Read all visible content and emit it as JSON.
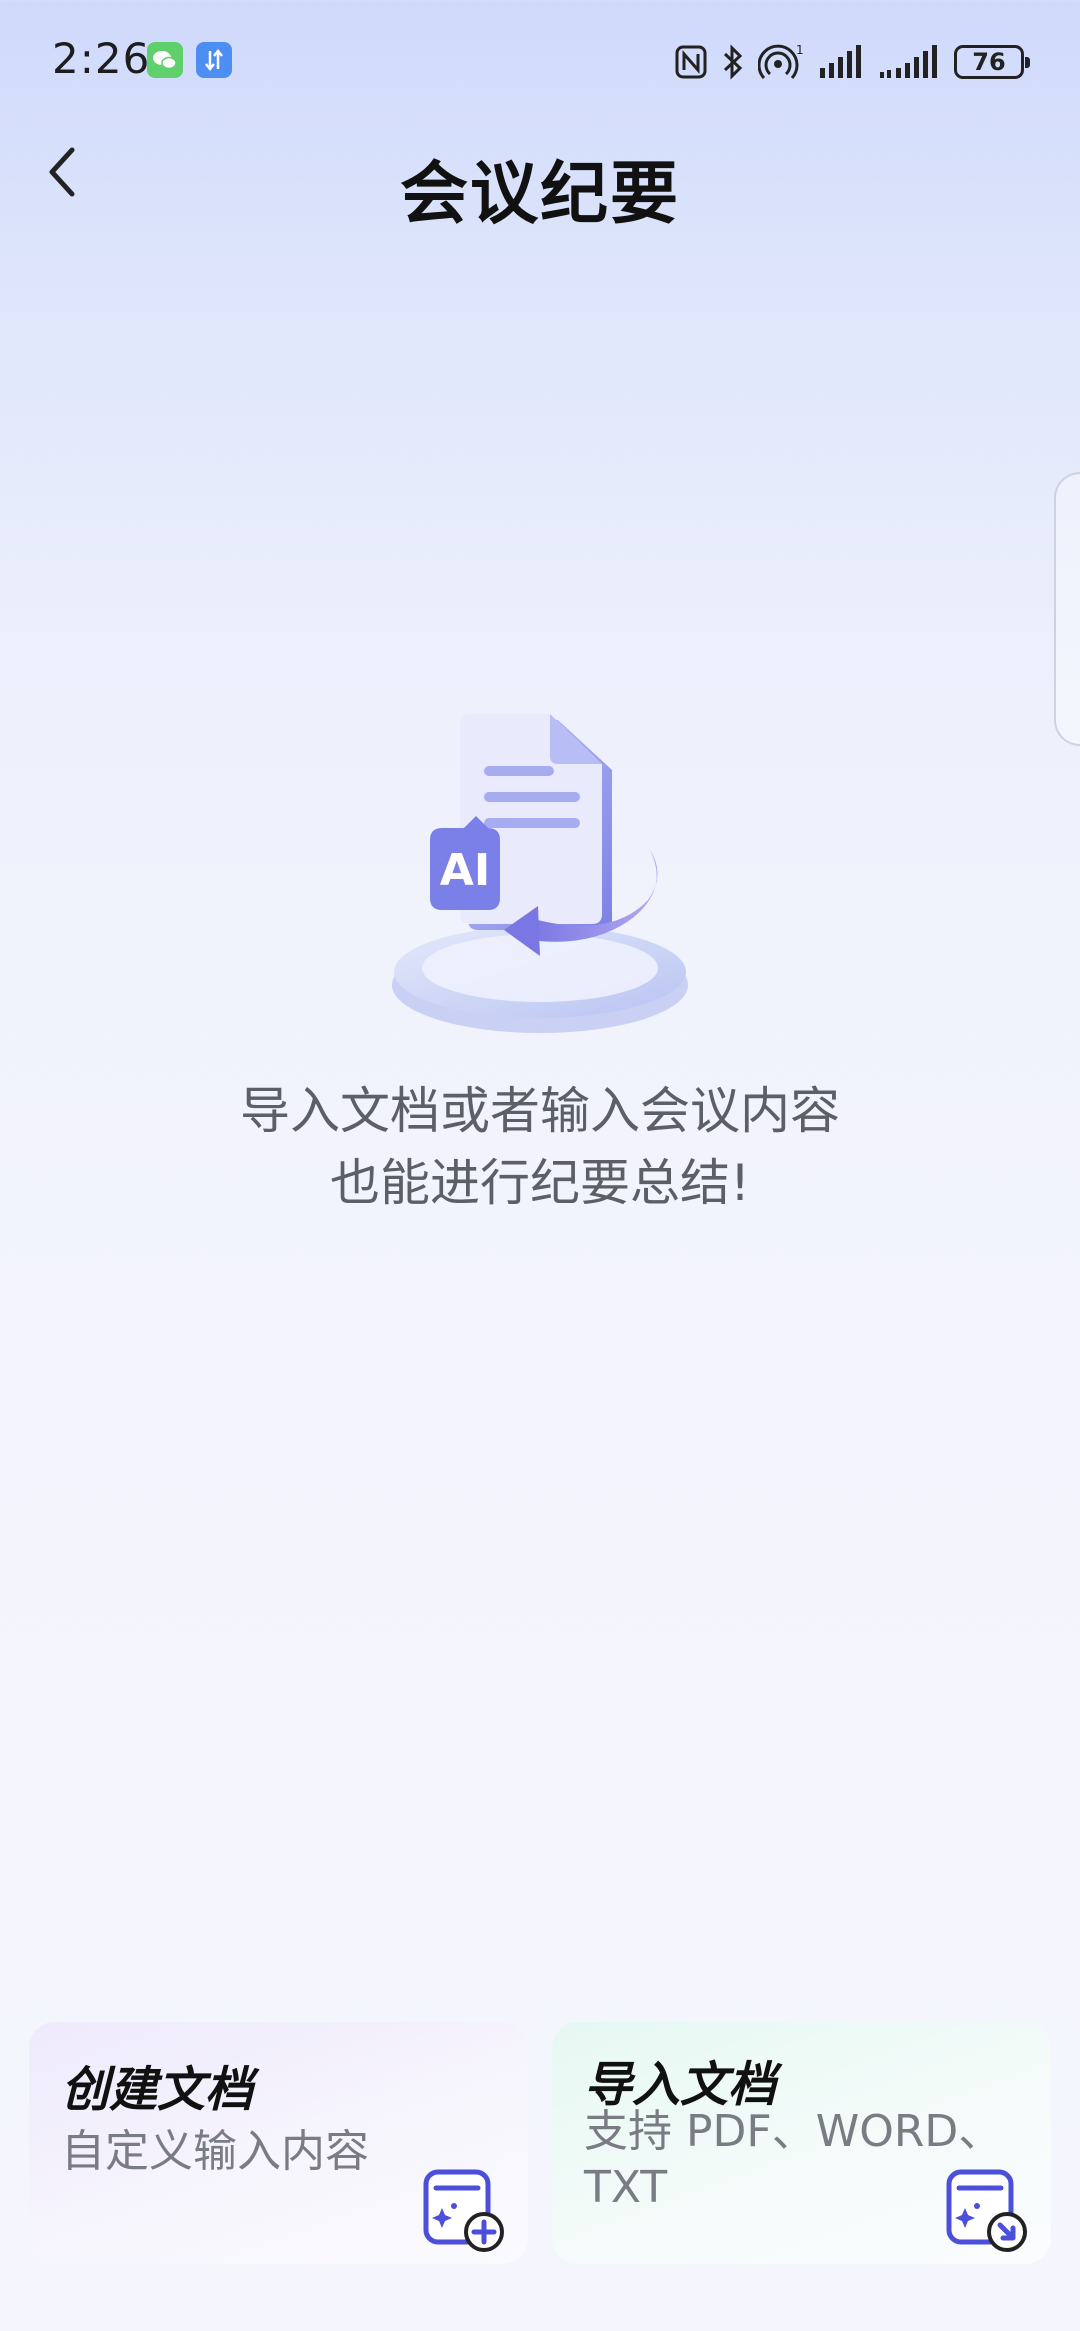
{
  "status_bar": {
    "time": "2:26",
    "battery_level": "76",
    "app_icons": [
      "wechat-icon",
      "transfer-icon"
    ],
    "system_icons": [
      "nfc-icon",
      "bluetooth-icon",
      "hotspot-icon",
      "signal-icon",
      "signal-icon"
    ]
  },
  "header": {
    "title": "会议纪要",
    "back_icon": "chevron-left-icon"
  },
  "empty_state": {
    "illustration": "ai-document-icon",
    "badge_text": "AI",
    "line1": "导入文档或者输入会议内容",
    "line2": "也能进行纪要总结!"
  },
  "cards": [
    {
      "title": "创建文档",
      "subtitle": "自定义输入内容",
      "icon": "create-document-icon",
      "accent": "#4b4fd9"
    },
    {
      "title": "导入文档",
      "subtitle": "支持 PDF、WORD、TXT",
      "icon": "import-document-icon",
      "accent": "#4b4fd9"
    }
  ],
  "colors": {
    "background_top": "#cfd9fb",
    "background_bottom": "#f5f6fd",
    "accent": "#5b5ee6"
  }
}
